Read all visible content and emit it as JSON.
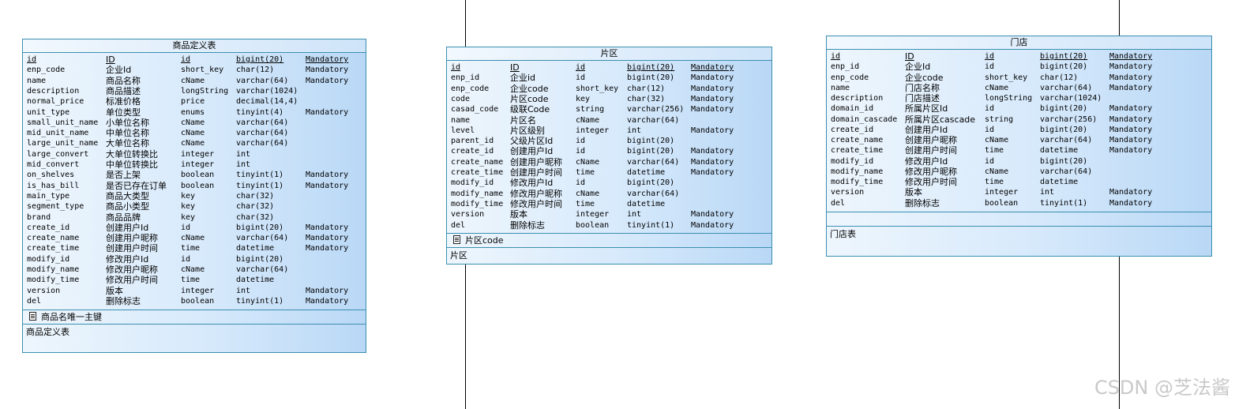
{
  "tables": [
    {
      "title": "商品定义表",
      "rows": [
        {
          "code": "id",
          "name": "ID",
          "domain": "id",
          "type": "bigint(20)",
          "mandatory": "Mandatory",
          "pk": true
        },
        {
          "code": "enp_code",
          "name": "企业Id",
          "domain": "short_key",
          "type": "char(12)",
          "mandatory": "Mandatory"
        },
        {
          "code": "name",
          "name": "商品名称",
          "domain": "cName",
          "type": "varchar(64)",
          "mandatory": "Mandatory"
        },
        {
          "code": "description",
          "name": "商品描述",
          "domain": "longString",
          "type": "varchar(1024)",
          "mandatory": ""
        },
        {
          "code": "normal_price",
          "name": "标准价格",
          "domain": "price",
          "type": "decimal(14,4)",
          "mandatory": ""
        },
        {
          "code": "unit_type",
          "name": "单位类型",
          "domain": "enums",
          "type": "tinyint(4)",
          "mandatory": "Mandatory"
        },
        {
          "code": "small_unit_name",
          "name": "小单位名称",
          "domain": "cName",
          "type": "varchar(64)",
          "mandatory": ""
        },
        {
          "code": "mid_unit_name",
          "name": "中单位名称",
          "domain": "cName",
          "type": "varchar(64)",
          "mandatory": ""
        },
        {
          "code": "large_unit_name",
          "name": "大单位名称",
          "domain": "cName",
          "type": "varchar(64)",
          "mandatory": ""
        },
        {
          "code": "large_convert",
          "name": "大单位转换比",
          "domain": "integer",
          "type": "int",
          "mandatory": ""
        },
        {
          "code": "mid_convert",
          "name": "中单位转换比",
          "domain": "integer",
          "type": "int",
          "mandatory": ""
        },
        {
          "code": "on_shelves",
          "name": "是否上架",
          "domain": "boolean",
          "type": "tinyint(1)",
          "mandatory": "Mandatory"
        },
        {
          "code": "is_has_bill",
          "name": "是否已存在订单",
          "domain": "boolean",
          "type": "tinyint(1)",
          "mandatory": "Mandatory"
        },
        {
          "code": "main_type",
          "name": "商品大类型",
          "domain": "key",
          "type": "char(32)",
          "mandatory": ""
        },
        {
          "code": "segment_type",
          "name": "商品小类型",
          "domain": "key",
          "type": "char(32)",
          "mandatory": ""
        },
        {
          "code": "brand",
          "name": "商品品牌",
          "domain": "key",
          "type": "char(32)",
          "mandatory": ""
        },
        {
          "code": "create_id",
          "name": "创建用户Id",
          "domain": "id",
          "type": "bigint(20)",
          "mandatory": "Mandatory"
        },
        {
          "code": "create_name",
          "name": "创建用户昵称",
          "domain": "cName",
          "type": "varchar(64)",
          "mandatory": "Mandatory"
        },
        {
          "code": "create_time",
          "name": "创建用户时间",
          "domain": "time",
          "type": "datetime",
          "mandatory": "Mandatory"
        },
        {
          "code": "modify_id",
          "name": "修改用户Id",
          "domain": "id",
          "type": "bigint(20)",
          "mandatory": ""
        },
        {
          "code": "modify_name",
          "name": "修改用户昵称",
          "domain": "cName",
          "type": "varchar(64)",
          "mandatory": ""
        },
        {
          "code": "modify_time",
          "name": "修改用户时间",
          "domain": "time",
          "type": "datetime",
          "mandatory": ""
        },
        {
          "code": "version",
          "name": "版本",
          "domain": "integer",
          "type": "int",
          "mandatory": "Mandatory"
        },
        {
          "code": "del",
          "name": "删除标志",
          "domain": "boolean",
          "type": "tinyint(1)",
          "mandatory": "Mandatory"
        }
      ],
      "key_label": "商品名唯一主键",
      "comment": "商品定义表"
    },
    {
      "title": "片区",
      "rows": [
        {
          "code": "id",
          "name": "ID",
          "domain": "id",
          "type": "bigint(20)",
          "mandatory": "Mandatory",
          "pk": true
        },
        {
          "code": "enp_id",
          "name": "企业id",
          "domain": "id",
          "type": "bigint(20)",
          "mandatory": "Mandatory"
        },
        {
          "code": "enp_code",
          "name": "企业code",
          "domain": "short_key",
          "type": "char(12)",
          "mandatory": "Mandatory"
        },
        {
          "code": "code",
          "name": "片区code",
          "domain": "key",
          "type": "char(32)",
          "mandatory": "Mandatory"
        },
        {
          "code": "casad_code",
          "name": "级联Code",
          "domain": "string",
          "type": "varchar(256)",
          "mandatory": "Mandatory"
        },
        {
          "code": "name",
          "name": "片区名",
          "domain": "cName",
          "type": "varchar(64)",
          "mandatory": ""
        },
        {
          "code": "level",
          "name": "片区级别",
          "domain": "integer",
          "type": "int",
          "mandatory": "Mandatory"
        },
        {
          "code": "parent_id",
          "name": "父级片区Id",
          "domain": "id",
          "type": "bigint(20)",
          "mandatory": ""
        },
        {
          "code": "create_id",
          "name": "创建用户Id",
          "domain": "id",
          "type": "bigint(20)",
          "mandatory": "Mandatory"
        },
        {
          "code": "create_name",
          "name": "创建用户昵称",
          "domain": "cName",
          "type": "varchar(64)",
          "mandatory": "Mandatory"
        },
        {
          "code": "create_time",
          "name": "创建用户时间",
          "domain": "time",
          "type": "datetime",
          "mandatory": "Mandatory"
        },
        {
          "code": "modify_id",
          "name": "修改用户Id",
          "domain": "id",
          "type": "bigint(20)",
          "mandatory": ""
        },
        {
          "code": "modify_name",
          "name": "修改用户昵称",
          "domain": "cName",
          "type": "varchar(64)",
          "mandatory": ""
        },
        {
          "code": "modify_time",
          "name": "修改用户时间",
          "domain": "time",
          "type": "datetime",
          "mandatory": ""
        },
        {
          "code": "version",
          "name": "版本",
          "domain": "integer",
          "type": "int",
          "mandatory": "Mandatory"
        },
        {
          "code": "del",
          "name": "删除标志",
          "domain": "boolean",
          "type": "tinyint(1)",
          "mandatory": "Mandatory"
        }
      ],
      "key_label": "片区code",
      "comment": "片区"
    },
    {
      "title": "门店",
      "rows": [
        {
          "code": "id",
          "name": "ID",
          "domain": "id",
          "type": "bigint(20)",
          "mandatory": "Mandatory",
          "pk": true
        },
        {
          "code": "enp_id",
          "name": "企业Id",
          "domain": "id",
          "type": "bigint(20)",
          "mandatory": "Mandatory"
        },
        {
          "code": "enp_code",
          "name": "企业code",
          "domain": "short_key",
          "type": "char(12)",
          "mandatory": "Mandatory"
        },
        {
          "code": "name",
          "name": "门店名称",
          "domain": "cName",
          "type": "varchar(64)",
          "mandatory": "Mandatory"
        },
        {
          "code": "description",
          "name": "门店描述",
          "domain": "longString",
          "type": "varchar(1024)",
          "mandatory": ""
        },
        {
          "code": "domain_id",
          "name": "所属片区Id",
          "domain": "id",
          "type": "bigint(20)",
          "mandatory": "Mandatory"
        },
        {
          "code": "domain_cascade",
          "name": "所属片区cascade",
          "domain": "string",
          "type": "varchar(256)",
          "mandatory": "Mandatory"
        },
        {
          "code": "create_id",
          "name": "创建用户Id",
          "domain": "id",
          "type": "bigint(20)",
          "mandatory": "Mandatory"
        },
        {
          "code": "create_name",
          "name": "创建用户昵称",
          "domain": "cName",
          "type": "varchar(64)",
          "mandatory": "Mandatory"
        },
        {
          "code": "create_time",
          "name": "创建用户时间",
          "domain": "time",
          "type": "datetime",
          "mandatory": "Mandatory"
        },
        {
          "code": "modify_id",
          "name": "修改用户Id",
          "domain": "id",
          "type": "bigint(20)",
          "mandatory": ""
        },
        {
          "code": "modify_name",
          "name": "修改用户昵称",
          "domain": "cName",
          "type": "varchar(64)",
          "mandatory": ""
        },
        {
          "code": "modify_time",
          "name": "修改用户时间",
          "domain": "time",
          "type": "datetime",
          "mandatory": ""
        },
        {
          "code": "version",
          "name": "版本",
          "domain": "integer",
          "type": "int",
          "mandatory": "Mandatory"
        },
        {
          "code": "del",
          "name": "删除标志",
          "domain": "boolean",
          "type": "tinyint(1)",
          "mandatory": "Mandatory"
        }
      ],
      "key_label": "",
      "comment": "门店表"
    }
  ],
  "watermark": "CSDN @芝法酱"
}
